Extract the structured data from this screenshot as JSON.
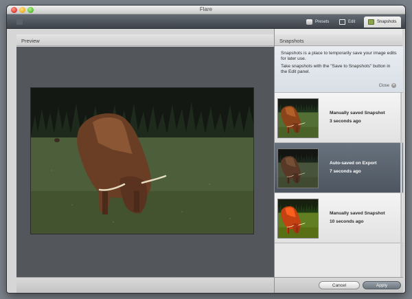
{
  "window": {
    "title": "Flare"
  },
  "toolbar": {
    "faded_button_label": "",
    "tabs": [
      {
        "label": "Presets",
        "icon": "presets-icon",
        "active": false
      },
      {
        "label": "Edit",
        "icon": "edit-icon",
        "active": false
      },
      {
        "label": "Snapshots",
        "icon": "snapshots-icon",
        "active": true
      }
    ]
  },
  "preview": {
    "header": "Preview"
  },
  "snapshots": {
    "header": "Snapshots",
    "info_line1": "Snapshots is a place to temporarily save your image edits for later use.",
    "info_line2": "Take snapshots with the \"Save to Snapshots\" button in the Edit panel.",
    "close_label": "Close",
    "items": [
      {
        "title": "Manually saved Snapshot",
        "time": "3 seconds ago",
        "selected": false
      },
      {
        "title": "Auto-saved on Export",
        "time": "7 seconds ago",
        "selected": true
      },
      {
        "title": "Manually saved Snapshot",
        "time": "10 seconds ago",
        "selected": false
      }
    ]
  },
  "footer": {
    "cancel_label": "Cancel",
    "apply_label": "Apply"
  },
  "colors": {
    "toolbar": "#4a5058",
    "selected_row": "#5a636e",
    "preview_bg": "#53575c"
  }
}
